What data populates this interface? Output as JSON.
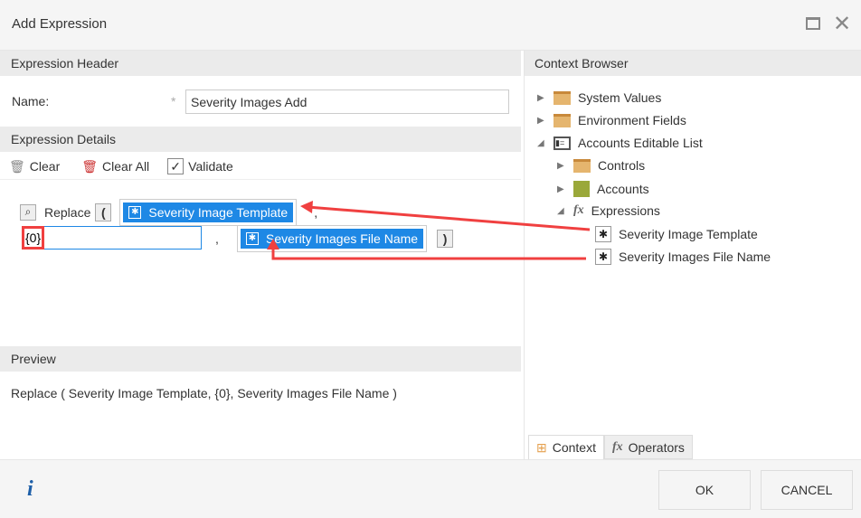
{
  "title": "Add Expression",
  "header": {
    "section": "Expression Header",
    "name_label": "Name:",
    "name_value": "Severity Images Add"
  },
  "details": {
    "section": "Expression Details",
    "clear": "Clear",
    "clear_all": "Clear All",
    "validate": "Validate",
    "func": "Replace",
    "open_paren": "(",
    "close_paren": ")",
    "arg1": "Severity Image Template",
    "sep": ",",
    "arg2_value": "{0}",
    "arg3": "Severity Images File Name"
  },
  "preview": {
    "section": "Preview",
    "text": "Replace ( Severity Image Template, {0}, Severity Images File Name )"
  },
  "context": {
    "section": "Context Browser",
    "items": [
      {
        "label": "System Values"
      },
      {
        "label": "Environment Fields"
      },
      {
        "label": "Accounts Editable List"
      },
      {
        "label": "Controls"
      },
      {
        "label": "Accounts"
      },
      {
        "label": "Expressions"
      },
      {
        "label": "Severity Image Template"
      },
      {
        "label": "Severity Images File Name"
      }
    ],
    "tabs": [
      "Context",
      "Operators"
    ]
  },
  "footer": {
    "ok": "OK",
    "cancel": "CANCEL"
  },
  "colors": {
    "accent": "#1e88e5",
    "arrow": "#f04040"
  }
}
